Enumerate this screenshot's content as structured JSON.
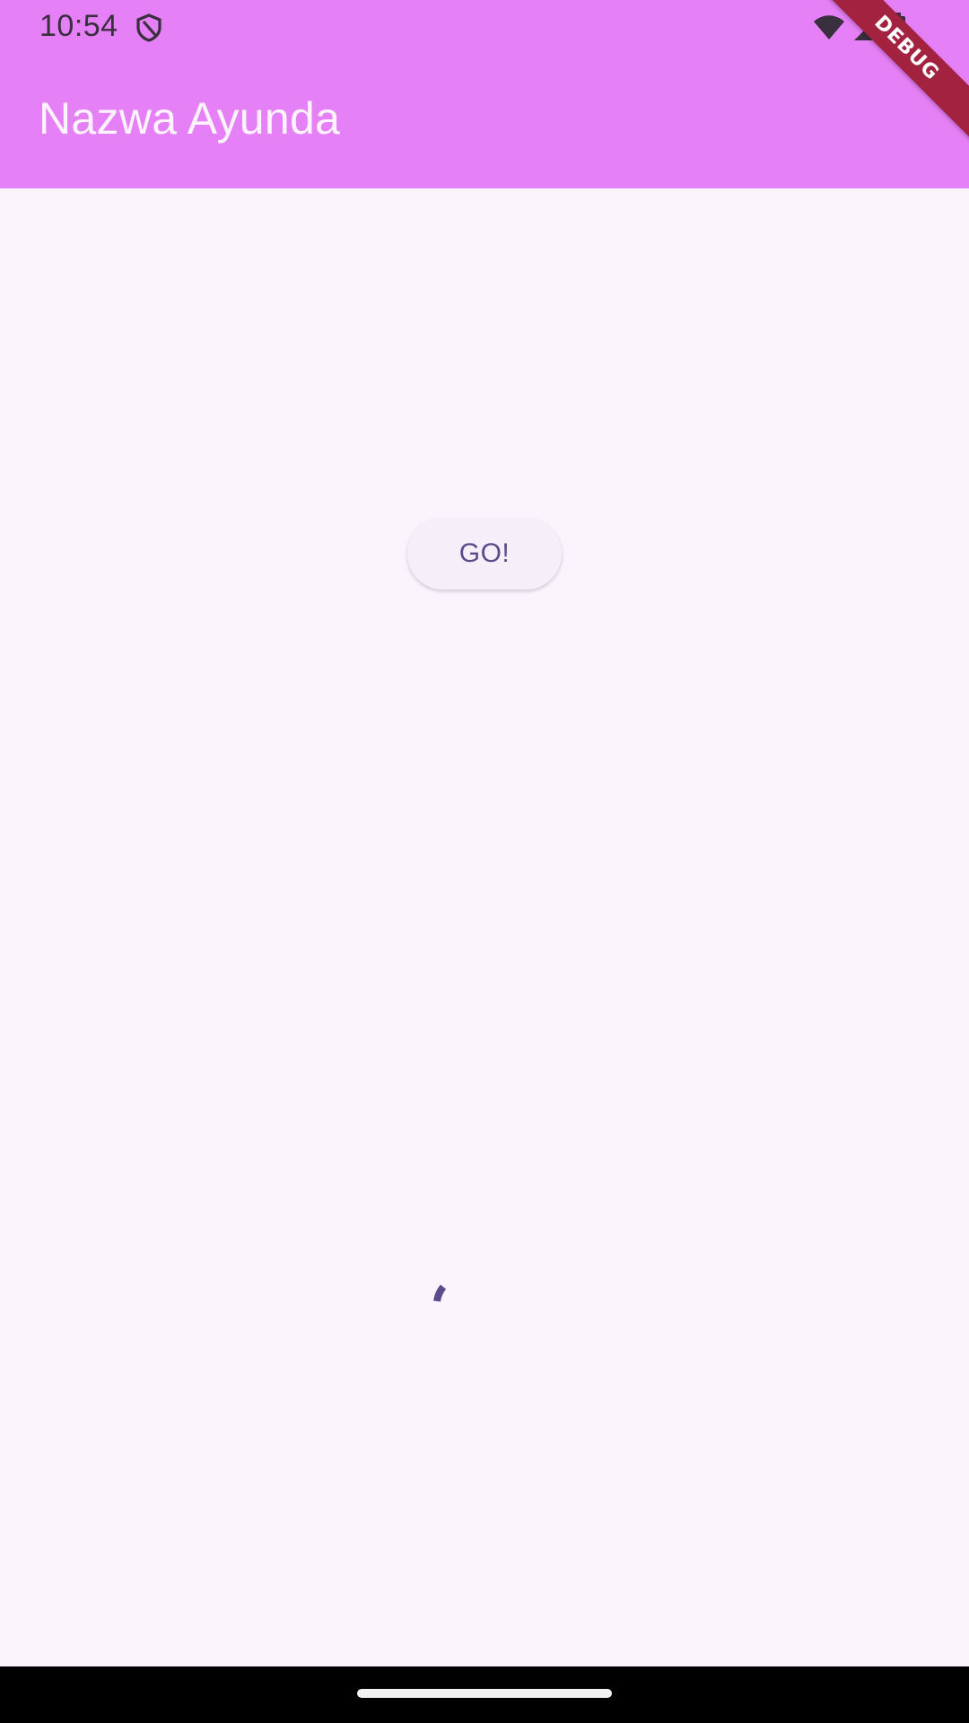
{
  "status_bar": {
    "time": "10:54",
    "icons": [
      "shield-icon",
      "wifi-icon",
      "signal-icon",
      "battery-icon"
    ]
  },
  "app_bar": {
    "title": "Nazwa Ayunda",
    "background": "#e680f6"
  },
  "debug_banner": {
    "label": "DEBUG",
    "color": "#a3223f"
  },
  "main": {
    "go_button_label": "GO!",
    "background": "#fcf4fd"
  },
  "loading_indicator": {
    "state": "loading",
    "color": "#5b4b8a"
  }
}
